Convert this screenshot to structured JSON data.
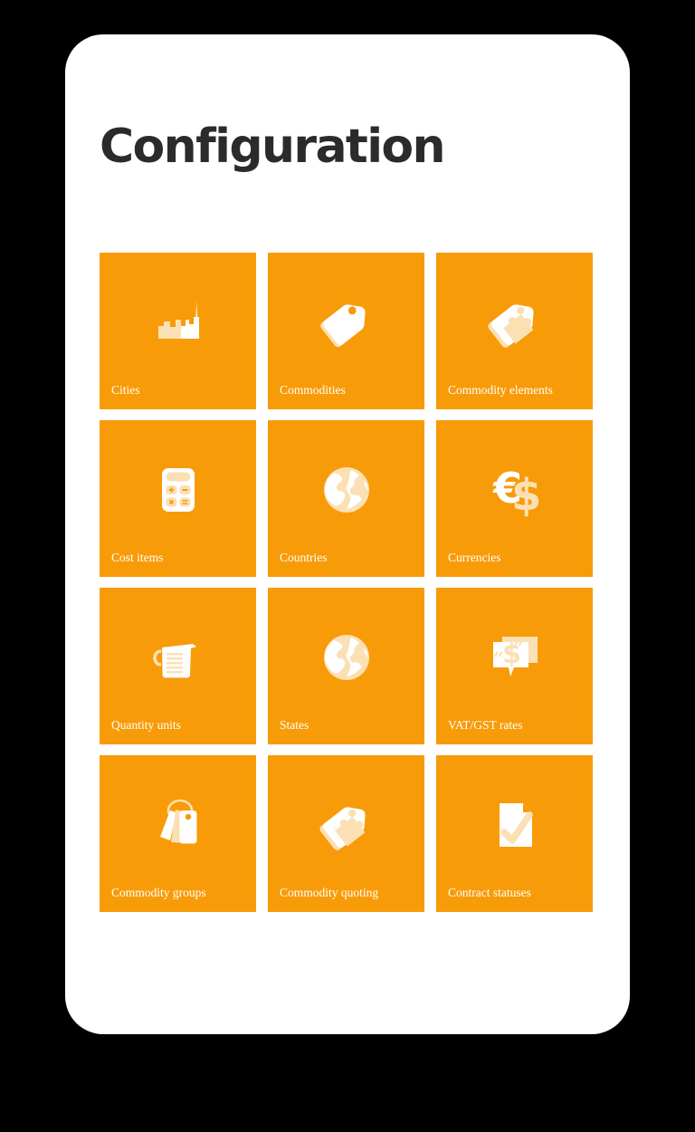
{
  "page": {
    "title": "Configuration",
    "background_color": "#000000",
    "card_color": "#ffffff"
  },
  "theme": {
    "tile_color": "#F89B08",
    "icon_white": "#ffffff",
    "icon_cream": "#FBE0B4",
    "label_color": "#ffffff",
    "title_color": "#2b2b2b"
  },
  "tiles": [
    {
      "label": "Cities",
      "icon": "city-skyline-icon"
    },
    {
      "label": "Commodities",
      "icon": "price-tags-icon"
    },
    {
      "label": "Commodity elements",
      "icon": "tag-puzzle-icon"
    },
    {
      "label": "Cost items",
      "icon": "calculator-icon"
    },
    {
      "label": "Countries",
      "icon": "globe-icon"
    },
    {
      "label": "Currencies",
      "icon": "euro-dollar-icon"
    },
    {
      "label": "Quantity units",
      "icon": "measuring-jug-icon"
    },
    {
      "label": "States",
      "icon": "globe-icon"
    },
    {
      "label": "VAT/GST rates",
      "icon": "quote-dollar-bubble-icon"
    },
    {
      "label": "Commodity groups",
      "icon": "tag-bundle-ring-icon"
    },
    {
      "label": "Commodity quoting",
      "icon": "tag-puzzle-icon"
    },
    {
      "label": "Contract statuses",
      "icon": "document-check-icon"
    }
  ]
}
